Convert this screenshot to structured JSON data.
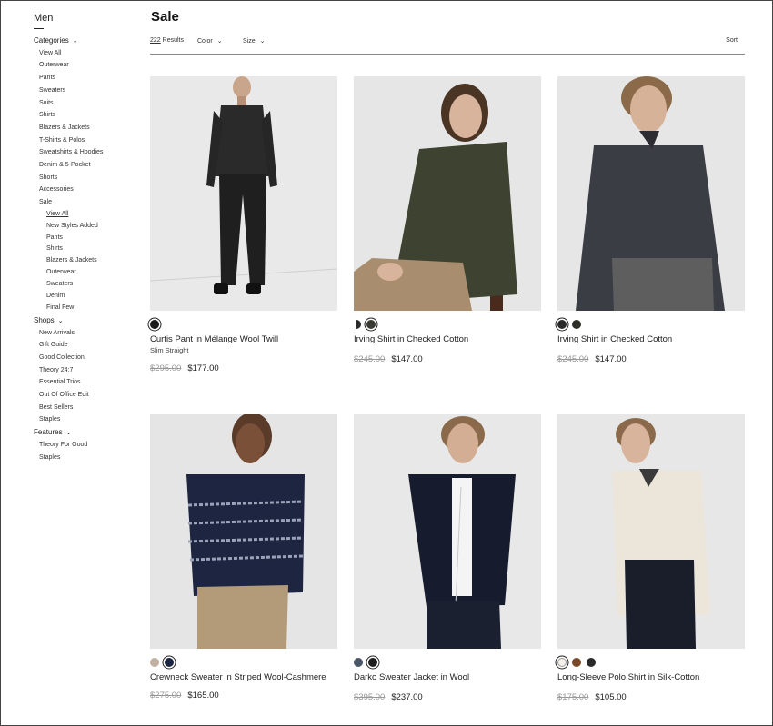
{
  "sidebar": {
    "title": "Men",
    "categories_label": "Categories",
    "categories": [
      "View All",
      "Outerwear",
      "Pants",
      "Sweaters",
      "Suits",
      "Shirts",
      "Blazers & Jackets",
      "T-Shirts & Polos",
      "Sweatshirts & Hoodies",
      "Denim & 5-Pocket",
      "Shorts",
      "Accessories",
      "Sale"
    ],
    "sale_items": [
      "View All",
      "New Styles Added",
      "Pants",
      "Shirts",
      "Blazers & Jackets",
      "Outerwear",
      "Sweaters",
      "Denim",
      "Final Few"
    ],
    "shops_label": "Shops",
    "shops": [
      "New Arrivals",
      "Gift Guide",
      "Good Collection",
      "Theory 24:7",
      "Essential Trios",
      "Out Of Office Edit",
      "Best Sellers",
      "Staples"
    ],
    "features_label": "Features",
    "features": [
      "Theory For Good",
      "Staples"
    ]
  },
  "page": {
    "title": "Sale",
    "results_count": "222",
    "results_label": "Results",
    "color_label": "Color",
    "size_label": "Size",
    "sort_label": "Sort"
  },
  "products": [
    {
      "name": "Curtis Pant in Mélange Wool Twill",
      "fit": "Slim Straight",
      "old_price": "$295.00",
      "price": "$177.00",
      "swatches": [
        "#1a1a1a"
      ]
    },
    {
      "name": "Irving Shirt in Checked Cotton",
      "fit": "",
      "old_price": "$245.00",
      "price": "$147.00",
      "swatches": [
        "#2b2b2b",
        "#3a3c33"
      ]
    },
    {
      "name": "Irving Shirt in Checked Cotton",
      "fit": "",
      "old_price": "$245.00",
      "price": "$147.00",
      "swatches": [
        "#2a2a2a",
        "#2e3028"
      ]
    },
    {
      "name": "Crewneck Sweater in Striped Wool-Cashmere",
      "fit": "",
      "old_price": "$275.00",
      "price": "$165.00",
      "swatches": [
        "#c2b1a0",
        "#1c2540"
      ]
    },
    {
      "name": "Darko Sweater Jacket in Wool",
      "fit": "",
      "old_price": "$395.00",
      "price": "$237.00",
      "swatches": [
        "#4a5566",
        "#1e1e1e"
      ]
    },
    {
      "name": "Long-Sleeve Polo Shirt in Silk-Cotton",
      "fit": "",
      "old_price": "$175.00",
      "price": "$105.00",
      "swatches": [
        "#f4f1ea",
        "#7a4a2a",
        "#2a2a2a"
      ]
    }
  ]
}
